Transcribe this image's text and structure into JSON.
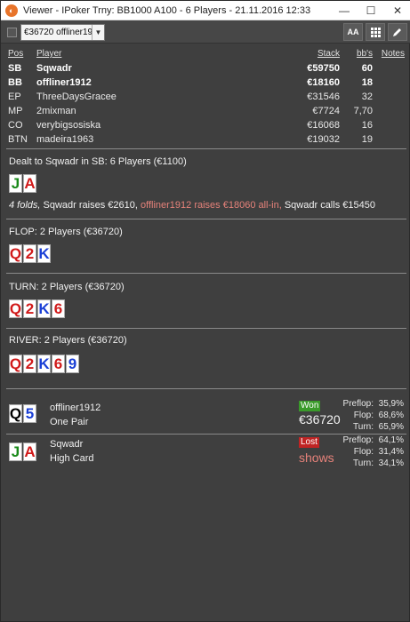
{
  "window": {
    "title": "Viewer - IPoker Trny: BB1000 A100 - 6 Players - 21.11.2016 12:33",
    "minimize": "—",
    "maximize": "☐",
    "close": "✕"
  },
  "toolbar": {
    "selected_hand": "€36720 offliner1912",
    "font_btn": "AA"
  },
  "players": {
    "headers": {
      "pos": "Pos",
      "player": "Player",
      "stack": "Stack",
      "bbs": "bb's",
      "notes": "Notes"
    },
    "rows": [
      {
        "pos": "SB",
        "name": "Sqwadr",
        "stack": "€59750",
        "bbs": "60"
      },
      {
        "pos": "BB",
        "name": "offliner1912",
        "stack": "€18160",
        "bbs": "18"
      },
      {
        "pos": "EP",
        "name": "ThreeDaysGracee",
        "stack": "€31546",
        "bbs": "32"
      },
      {
        "pos": "MP",
        "name": "2mixman",
        "stack": "€7724",
        "bbs": "7,70"
      },
      {
        "pos": "CO",
        "name": "verybigsosiska",
        "stack": "€16068",
        "bbs": "16"
      },
      {
        "pos": "BTN",
        "name": "madeira1963",
        "stack": "€19032",
        "bbs": "19"
      }
    ]
  },
  "preflop": {
    "title": "Dealt to Sqwadr in SB: 6 Players (€1100)",
    "cards": [
      {
        "rank": "J",
        "color": "green"
      },
      {
        "rank": "A",
        "color": "red"
      }
    ],
    "folds": "4 folds,",
    "action1": " Sqwadr raises €2610, ",
    "action2": "offliner1912 raises €18060 all-in,",
    "action3": " Sqwadr calls €15450"
  },
  "flop": {
    "title": "FLOP: 2 Players (€36720)",
    "cards": [
      {
        "rank": "Q",
        "color": "red"
      },
      {
        "rank": "2",
        "color": "red"
      },
      {
        "rank": "K",
        "color": "blue"
      }
    ]
  },
  "turn": {
    "title": "TURN: 2 Players (€36720)",
    "cards": [
      {
        "rank": "Q",
        "color": "red"
      },
      {
        "rank": "2",
        "color": "red"
      },
      {
        "rank": "K",
        "color": "blue"
      },
      {
        "rank": "6",
        "color": "red"
      }
    ]
  },
  "river": {
    "title": "RIVER: 2 Players (€36720)",
    "cards": [
      {
        "rank": "Q",
        "color": "red"
      },
      {
        "rank": "2",
        "color": "red"
      },
      {
        "rank": "K",
        "color": "blue"
      },
      {
        "rank": "6",
        "color": "red"
      },
      {
        "rank": "9",
        "color": "blue"
      }
    ]
  },
  "showdown": [
    {
      "name": "offliner1912",
      "hand": "One Pair",
      "result": "Won",
      "amount": "€36720",
      "cards": [
        {
          "rank": "Q",
          "color": "black"
        },
        {
          "rank": "5",
          "color": "blue"
        }
      ],
      "equity": [
        {
          "label": "Preflop:",
          "value": "35,9%"
        },
        {
          "label": "Flop:",
          "value": "68,6%"
        },
        {
          "label": "Turn:",
          "value": "65,9%"
        }
      ]
    },
    {
      "name": "Sqwadr",
      "hand": "High Card",
      "result": "Lost",
      "amount": "shows",
      "cards": [
        {
          "rank": "J",
          "color": "green"
        },
        {
          "rank": "A",
          "color": "red"
        }
      ],
      "equity": [
        {
          "label": "Preflop:",
          "value": "64,1%"
        },
        {
          "label": "Flop:",
          "value": "31,4%"
        },
        {
          "label": "Turn:",
          "value": "34,1%"
        }
      ]
    }
  ],
  "colors": {
    "background": "#3f3f3f",
    "won": "#3a9a2a",
    "lost": "#c02424",
    "hero_action": "#e6827a"
  }
}
